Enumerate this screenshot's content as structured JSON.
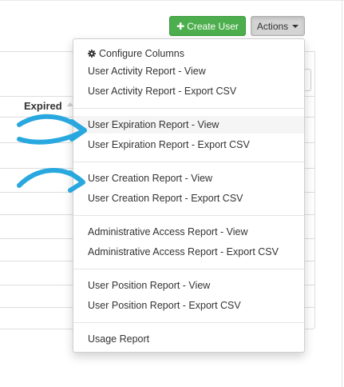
{
  "toolbar": {
    "create_user_label": "Create User",
    "actions_label": "Actions"
  },
  "table": {
    "column_header": "Expired"
  },
  "menu": {
    "groups": [
      [
        "Configure Columns",
        "User Activity Report - View",
        "User Activity Report - Export CSV"
      ],
      [
        "User Expiration Report - View",
        "User Expiration Report - Export CSV"
      ],
      [
        "User Creation Report - View",
        "User Creation Report - Export CSV"
      ],
      [
        "Administrative Access Report - View",
        "Administrative Access Report - Export CSV"
      ],
      [
        "User Position Report - View",
        "User Position Report - Export CSV"
      ],
      [
        "Usage Report"
      ]
    ]
  },
  "colors": {
    "create_button": "#4cae4c",
    "actions_button": "#d4d4d4",
    "annotation_arrow": "#29a8df",
    "hover_row": "#f5f5f5"
  },
  "icons": {
    "configure": "gear-icon",
    "create": "plus-icon",
    "actions": "caret-down-icon",
    "sort": "sort-up-icon"
  }
}
